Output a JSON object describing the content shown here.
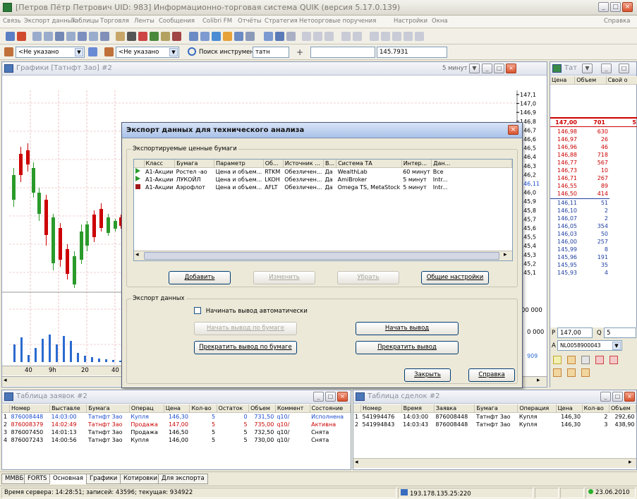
{
  "app": {
    "title": "[Петров Пётр Петрович  UID: 983] Информационно-торговая система QUIK (версия 5.17.0.139)"
  },
  "menu": [
    "Связь",
    "Экспорт данных",
    "Таблицы",
    "Торговля",
    "Ленты",
    "Сообщения",
    "Colibri FM",
    "Отчёты",
    "Стратегия",
    "Нетоорговые поручения",
    "Настройки",
    "Окна"
  ],
  "menu_help": "Справка",
  "toolbar2": {
    "account_combo": "<Не указано",
    "client_combo": "<Не указано",
    "search_label": "Поиск инструмента",
    "search_value": "татн",
    "price_value": "145.7931"
  },
  "chart_window": {
    "title": "Графики [Татнфт 3ао] #2",
    "interval": "5 минут",
    "y_ticks": [
      "147,1",
      "147,0",
      "146,9",
      "146,8",
      "146,7",
      "146,6",
      "146,5",
      "146,4",
      "146,3",
      "146,2",
      "146,11",
      "146,0",
      "145,9",
      "145,8",
      "145,7",
      "145,6",
      "145,5",
      "145,4",
      "145,3",
      "145,2",
      "145,1"
    ],
    "volume_ticks": [
      "00 000",
      "0 000"
    ],
    "x_ticks": [
      "40",
      "9h",
      "20",
      "40"
    ],
    "extra_label": "909"
  },
  "quote_window": {
    "title": "Тат",
    "headers": [
      "Цена",
      "Объем",
      "Свой о"
    ],
    "best": {
      "price": "147,00",
      "vol": "701",
      "own": "5"
    },
    "asks": [
      [
        "146,98",
        "630"
      ],
      [
        "146,97",
        "26"
      ],
      [
        "146,96",
        "46"
      ],
      [
        "146,88",
        "718"
      ],
      [
        "146,77",
        "567"
      ],
      [
        "146,73",
        "10"
      ],
      [
        "146,71",
        "267"
      ],
      [
        "146,55",
        "89"
      ],
      [
        "146,50",
        "414"
      ]
    ],
    "bids": [
      [
        "146,11",
        "51"
      ],
      [
        "146,10",
        "2"
      ],
      [
        "146,07",
        "2"
      ],
      [
        "146,05",
        "354"
      ],
      [
        "146,03",
        "50"
      ],
      [
        "146,00",
        "257"
      ],
      [
        "145,99",
        "8"
      ],
      [
        "145,96",
        "191"
      ],
      [
        "145,95",
        "35"
      ],
      [
        "145,93",
        "4"
      ]
    ],
    "p_label": "P",
    "p_value": "147,00",
    "q_label": "Q",
    "q_value": "5",
    "a_label": "A",
    "a_value": "NL0058900043"
  },
  "dialog": {
    "title": "Экспорт данных для технического анализа",
    "group1": "Экспортируемые ценные бумаги",
    "columns": [
      "",
      "Класс",
      "Бумага",
      "Параметр",
      "Об...",
      "Источник ...",
      "В...",
      "Система ТА",
      "Интер...",
      "Дан..."
    ],
    "rows": [
      {
        "status": "green",
        "cls": "А1-Акции",
        "sec": "Ростел -ао",
        "param": "Цена и объем...",
        "code": "RTKM",
        "src": "Обезличен...",
        "v": "Да",
        "sys": "WealthLab",
        "int": "60 минут",
        "dat": "Все"
      },
      {
        "status": "green",
        "cls": "А1-Акции",
        "sec": "ЛУКОЙЛ",
        "param": "Цена и объем...",
        "code": "LKOH",
        "src": "Обезличен...",
        "v": "Да",
        "sys": "AmiBroker",
        "int": "5 минут",
        "dat": "Intr..."
      },
      {
        "status": "red",
        "cls": "А1-Акции",
        "sec": "Аэрофлот",
        "param": "Цена и объем...",
        "code": "AFLT",
        "src": "Обезличен...",
        "v": "Да",
        "sys": "Omega TS, MetaStock",
        "int": "5 минут",
        "dat": "Intr..."
      }
    ],
    "btn_add": "Добавить",
    "btn_edit": "Изменить",
    "btn_remove": "Убрать",
    "btn_settings": "Общие настройки",
    "group2": "Экспорт данных",
    "chk_auto": "Начинать вывод автоматически",
    "btn_start_sec": "Начать вывод по бумаге",
    "btn_stop_sec": "Прекратить вывод по бумаге",
    "btn_start": "Начать вывод",
    "btn_stop": "Прекратить вывод",
    "btn_close": "Закрыть",
    "btn_help": "Справка"
  },
  "orders_window": {
    "title": "Таблица заявок #2",
    "headers": [
      "Номер",
      "Выставле",
      "Бумага",
      "Операц",
      "Цена",
      "Кол-во",
      "Остаток",
      "Объем",
      "Коммент",
      "Состояние"
    ],
    "rows": [
      [
        "876008448",
        "14:03:00",
        "Татнфт 3ао",
        "Купля",
        "146,30",
        "5",
        "0",
        "731,50",
        "q10/",
        "Исполнена"
      ],
      [
        "876008379",
        "14:02:49",
        "Татнфт 3ао",
        "Продажа",
        "147,00",
        "5",
        "5",
        "735,00",
        "q10/",
        "Активна"
      ],
      [
        "876007450",
        "14:01:13",
        "Татнфт 3ао",
        "Продажа",
        "146,50",
        "5",
        "5",
        "732,50",
        "q10/",
        "Снята"
      ],
      [
        "876007243",
        "14:00:56",
        "Татнфт 3ао",
        "Купля",
        "146,00",
        "5",
        "5",
        "730,00",
        "q10/",
        "Снята"
      ]
    ]
  },
  "trades_window": {
    "title": "Таблица сделок #2",
    "headers": [
      "Номер",
      "Время",
      "Заявка",
      "Бумага",
      "Операция",
      "Цена",
      "Кол-во",
      "Объем"
    ],
    "rows": [
      [
        "541994476",
        "14:03:00",
        "876008448",
        "Татнфт 3ао",
        "Купля",
        "146,30",
        "2",
        "292,60"
      ],
      [
        "541994843",
        "14:03:43",
        "876008448",
        "Татнфт 3ао",
        "Купля",
        "146,30",
        "3",
        "438,90"
      ]
    ]
  },
  "tabs": [
    "ММВБ",
    "FORTS",
    "Основная",
    "Графики",
    "Котировки",
    "Для экспорта"
  ],
  "status": {
    "server": "Время сервера: 14:28:51; записей: 43596; текущая: 934922",
    "ip": "193.178.135.25:220",
    "date": "23.06.2010"
  }
}
